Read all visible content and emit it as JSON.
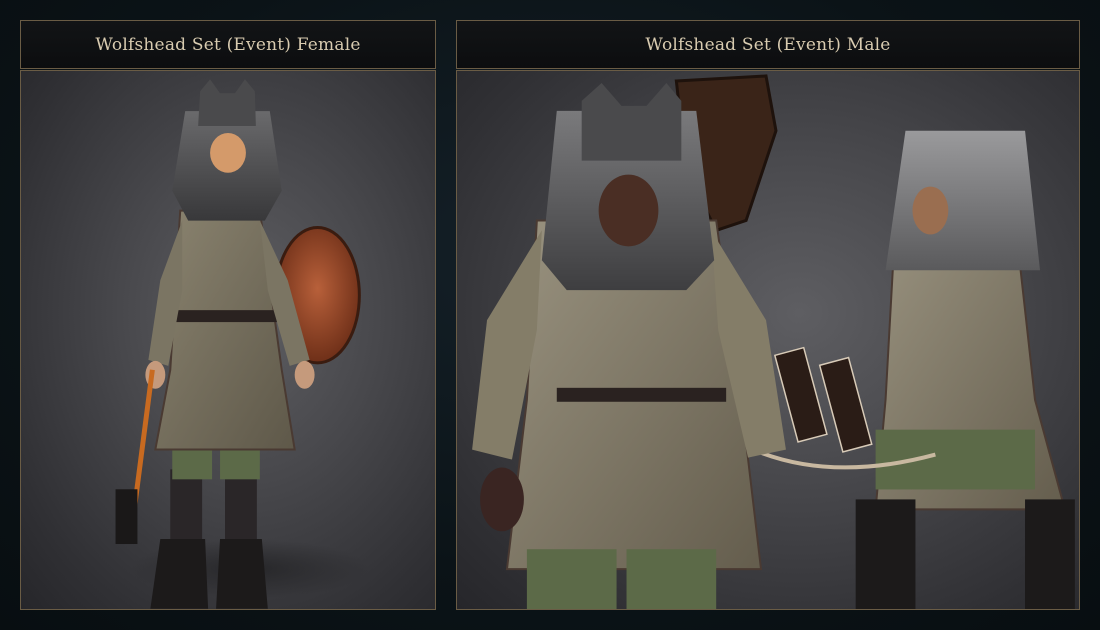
{
  "panels": [
    {
      "title": "Wolfshead Set (Event) Female",
      "image": "female-character-render"
    },
    {
      "title": "Wolfshead Set (Event) Male",
      "image": "male-characters-render"
    }
  ],
  "colors": {
    "page_background": "#0a1216",
    "header_background": "#0f1113",
    "border_gold": "#6a5c45",
    "title_text": "#d8cbb0",
    "render_background": "#48484c"
  }
}
